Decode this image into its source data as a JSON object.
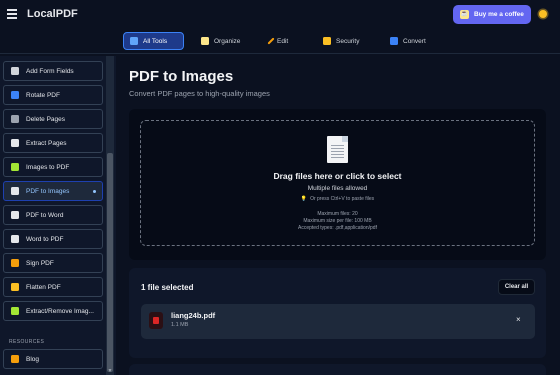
{
  "app": {
    "name": "LocalPDF"
  },
  "header": {
    "coffee_label": "Buy me a coffee"
  },
  "tabs": [
    {
      "label": "All Tools",
      "icon": "grid-icon",
      "active": true
    },
    {
      "label": "Organize",
      "icon": "clipboard-icon"
    },
    {
      "label": "Edit",
      "icon": "pencil-icon"
    },
    {
      "label": "Security",
      "icon": "lock-icon"
    },
    {
      "label": "Convert",
      "icon": "convert-icon"
    }
  ],
  "sidebar": {
    "items": [
      {
        "label": "Add Form Fields",
        "icon": "clipboard-icon",
        "color": "#d1d5db"
      },
      {
        "label": "Rotate PDF",
        "icon": "rotate-icon",
        "color": "#3b82f6"
      },
      {
        "label": "Delete Pages",
        "icon": "trash-icon",
        "color": "#9ca3af"
      },
      {
        "label": "Extract Pages",
        "icon": "document-icon",
        "color": "#e5e7eb"
      },
      {
        "label": "Images to PDF",
        "icon": "image-icon",
        "color": "#a3e635"
      },
      {
        "label": "PDF to Images",
        "icon": "camera-icon",
        "color": "#e5e7eb",
        "active": true
      },
      {
        "label": "PDF to Word",
        "icon": "document-icon",
        "color": "#e5e7eb"
      },
      {
        "label": "Word to PDF",
        "icon": "document-icon",
        "color": "#e5e7eb"
      },
      {
        "label": "Sign PDF",
        "icon": "signature-icon",
        "color": "#f59e0b"
      },
      {
        "label": "Flatten PDF",
        "icon": "pencil-icon",
        "color": "#fbbf24"
      },
      {
        "label": "Extract/Remove Imag...",
        "icon": "image-icon",
        "color": "#a3e635"
      }
    ],
    "resources_label": "RESOURCES",
    "resources": [
      {
        "label": "Blog",
        "icon": "pencil-icon",
        "color": "#f59e0b"
      }
    ]
  },
  "main": {
    "title": "PDF to Images",
    "subtitle": "Convert PDF pages to high-quality images"
  },
  "dropzone": {
    "title": "Drag files here or click to select",
    "multiple": "Multiple files allowed",
    "paste_hint": "Or press Ctrl+V to paste files",
    "max_files": "Maximum files: 20",
    "max_size": "Maximum size per file: 100 MB",
    "accepted": "Accepted types: .pdf,application/pdf"
  },
  "files": {
    "title": "1 file selected",
    "clear_label": "Clear all",
    "items": [
      {
        "name": "liang24b.pdf",
        "size": "1.1 MB"
      }
    ],
    "remove_glyph": "×"
  },
  "colors": {
    "accent": "#6366f1",
    "active_tab_bg": "#1e3a8a",
    "background": "#0b1120"
  }
}
